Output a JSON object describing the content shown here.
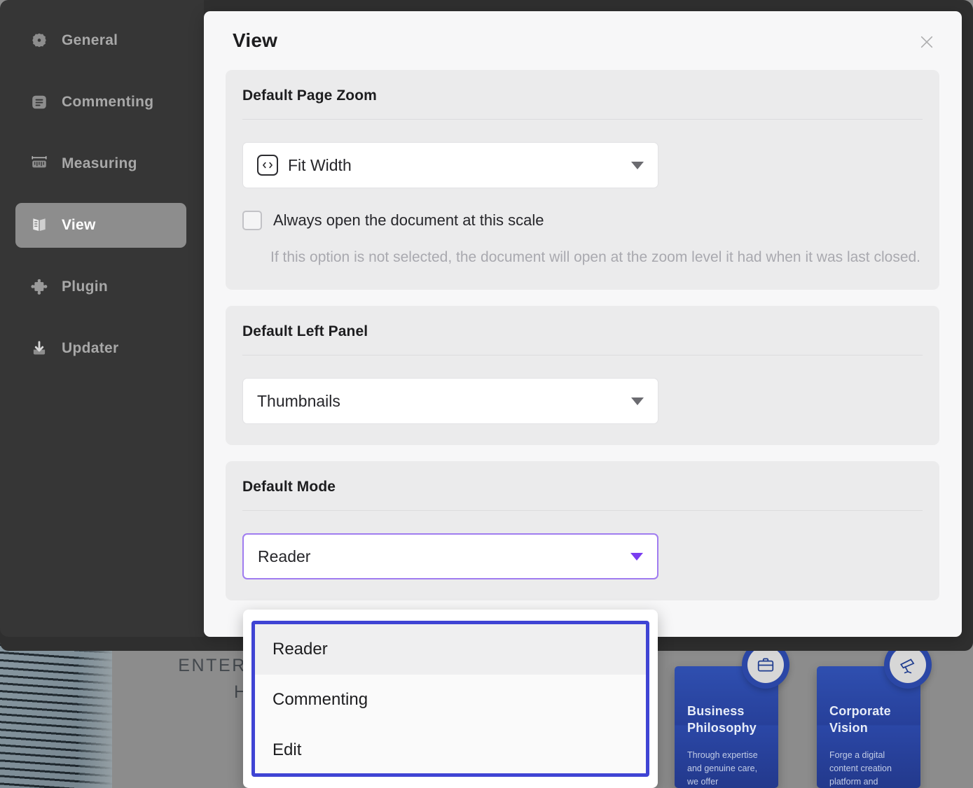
{
  "sidebar": {
    "items": [
      {
        "label": "General",
        "icon": "gear-icon",
        "active": false
      },
      {
        "label": "Commenting",
        "icon": "comment-icon",
        "active": false
      },
      {
        "label": "Measuring",
        "icon": "ruler-icon",
        "active": false
      },
      {
        "label": "View",
        "icon": "book-open-icon",
        "active": true
      },
      {
        "label": "Plugin",
        "icon": "puzzle-icon",
        "active": false
      },
      {
        "label": "Updater",
        "icon": "download-icon",
        "active": false
      }
    ]
  },
  "dialog": {
    "title": "View",
    "close_icon": "close-icon",
    "sections": {
      "page_zoom": {
        "title": "Default Page Zoom",
        "select_value": "Fit Width",
        "select_icon": "fit-width-icon",
        "checkbox_label": "Always open the document at this scale",
        "checkbox_checked": false,
        "hint": "If this option is not selected, the document will open at the zoom level it had when it was last closed."
      },
      "left_panel": {
        "title": "Default Left Panel",
        "select_value": "Thumbnails"
      },
      "mode": {
        "title": "Default Mode",
        "select_value": "Reader",
        "options": [
          {
            "label": "Reader",
            "selected": true
          },
          {
            "label": "Commenting",
            "selected": false
          },
          {
            "label": "Edit",
            "selected": false
          }
        ]
      }
    }
  },
  "background_document": {
    "heading_line1": "ENTERPRISE",
    "heading_line2": "HONOR",
    "cards": [
      {
        "icon": "briefcase-icon",
        "title": "Business Philosophy",
        "body": "Through expertise and genuine care, we offer"
      },
      {
        "icon": "telescope-icon",
        "title": "Corporate Vision",
        "body": "Forge a digital content creation platform and"
      }
    ]
  },
  "colors": {
    "sidebar_bg": "#363636",
    "dialog_bg": "#f7f7f8",
    "section_bg": "#ebebec",
    "focus_purple": "#a07cf0",
    "dropdown_blue": "#3f44d4",
    "card_blue": "#27409a"
  }
}
